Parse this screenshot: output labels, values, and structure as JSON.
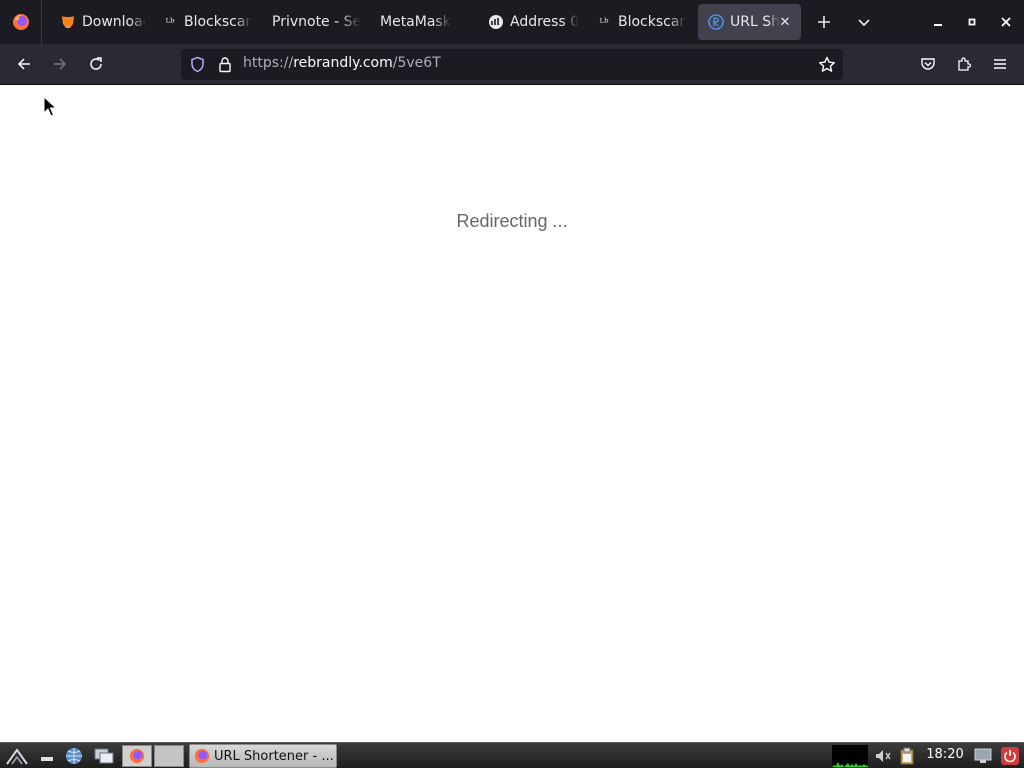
{
  "browser": {
    "tabs": [
      {
        "title": "Download",
        "icon": "metamask-fox-icon",
        "active": false
      },
      {
        "title": "Blockscan",
        "icon": "blockscan-icon",
        "active": false
      },
      {
        "title": "Privnote - Se",
        "icon": "",
        "active": false
      },
      {
        "title": "MetaMask",
        "icon": "",
        "active": false
      },
      {
        "title": "Address 0",
        "icon": "etherscan-icon",
        "active": false
      },
      {
        "title": "Blockscan",
        "icon": "blockscan-icon",
        "active": false
      },
      {
        "title": "URL Sho",
        "icon": "rebrandly-icon",
        "active": true
      }
    ],
    "url": {
      "scheme": "https://",
      "host": "rebrandly.com",
      "path": "/5ve6T"
    }
  },
  "page": {
    "message": "Redirecting ..."
  },
  "taskbar": {
    "task_title": "URL Shortener - ...",
    "clock": "18:20"
  },
  "colors": {
    "tabbar_bg": "#1c1b22",
    "navbar_bg": "#2b2a33",
    "active_tab": "#42414d",
    "text_muted": "#666666"
  }
}
